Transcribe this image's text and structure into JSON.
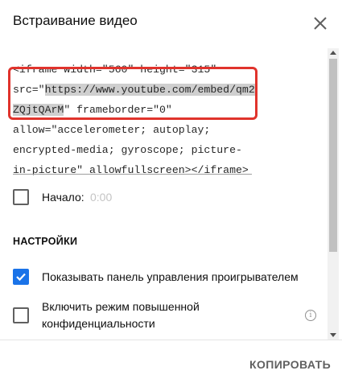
{
  "dialog": {
    "title": "Встраивание видео",
    "close_icon": "close-icon"
  },
  "embed_code": {
    "line1": "<iframe width=\"560\" height=\"315\"",
    "line2_prefix": "src=\"",
    "line2_highlight": "https://www.youtube.com/embed/qm2",
    "line3_highlight": "ZQjtQArM",
    "line3_rest": "\" frameborder=\"0\"",
    "line4": "allow=\"accelerometer; autoplay;",
    "line5": "encrypted-media; gyroscope; picture-",
    "line6": "in-picture\" allowfullscreen></iframe>"
  },
  "start": {
    "label": "Начало:",
    "time": "0:00",
    "checked": false
  },
  "settings": {
    "heading": "НАСТРОЙКИ",
    "options": [
      {
        "label": "Показывать панель управления проигрывателем",
        "checked": true
      },
      {
        "label_line1": "Включить режим повышенной",
        "label_line2": "конфиденциальности",
        "checked": false,
        "info_icon": "info-icon"
      }
    ]
  },
  "footer": {
    "copy_label": "КОПИРОВАТЬ"
  },
  "colors": {
    "accent": "#1a73e8",
    "highlight_box": "#e0332c"
  }
}
